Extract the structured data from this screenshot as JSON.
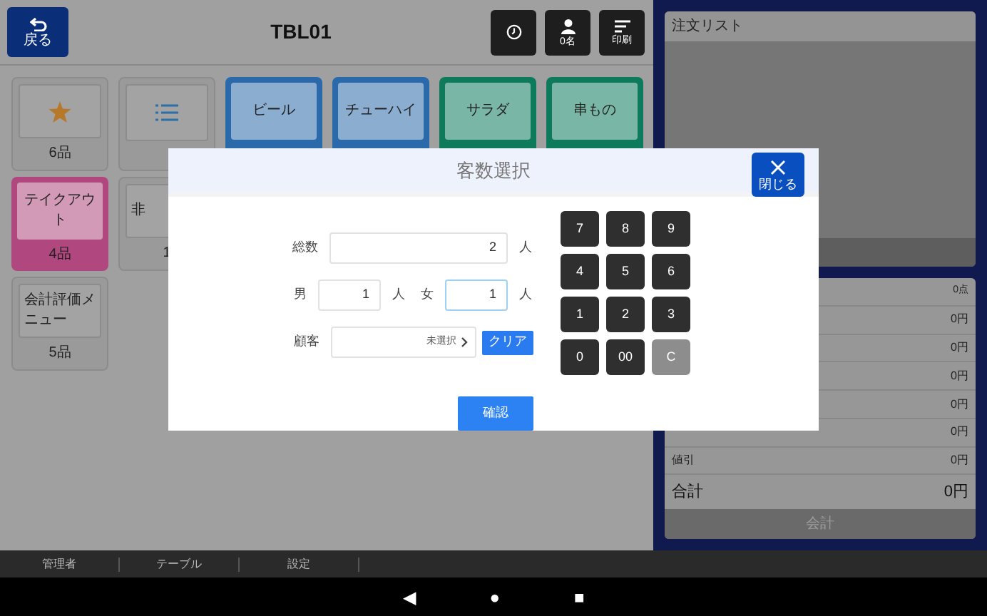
{
  "header": {
    "back_button": "戻る",
    "title": "TBL01",
    "buttons": [
      {
        "kind": "clock"
      },
      {
        "kind": "person",
        "label": "0名"
      },
      {
        "kind": "lines",
        "label": "印刷"
      }
    ]
  },
  "categories": [
    {
      "kind": "star",
      "count": "6品"
    },
    {
      "kind": "list"
    },
    {
      "kind": "color",
      "label": "ビール",
      "color": "#2a6aaa"
    },
    {
      "kind": "color",
      "label": "チューハイ",
      "color": "#2a6aaa"
    },
    {
      "kind": "color",
      "label": "サラダ",
      "color": "#0e7a5c"
    },
    {
      "kind": "color",
      "label": "串もの",
      "color": "#0e7a5c"
    },
    {
      "kind": "color",
      "label": "テイクアウト",
      "count": "4品",
      "color": "#b0477f",
      "new_row": true
    },
    {
      "kind": "plain",
      "label": "非",
      "count": "1"
    },
    {
      "kind": "plain",
      "label": "会計評価メニュー",
      "count": "5品",
      "new_row": true
    }
  ],
  "order_list": {
    "title": "注文リスト"
  },
  "summary": {
    "rows": [
      {
        "value": "0点"
      },
      {
        "value": "0円"
      },
      {
        "value": "0円"
      },
      {
        "value": "0円"
      },
      {
        "value": "0円"
      },
      {
        "value": "0円"
      },
      {
        "label": "値引",
        "value": "0円"
      }
    ],
    "total": {
      "label": "合計",
      "value": "0円"
    },
    "checkout_button": "会計"
  },
  "dialog": {
    "title": "客数選択",
    "close_button": "閉じる",
    "total": {
      "label": "総数",
      "value": "2",
      "unit": "人",
      "focused": false
    },
    "male": {
      "label": "男",
      "value": "1",
      "unit": "人",
      "focused": false
    },
    "female": {
      "label": "女",
      "value": "1",
      "unit": "人",
      "focused": true
    },
    "customer": {
      "label": "顧客",
      "value": "未選択",
      "clear_button": "クリア"
    },
    "confirm_button": "確認",
    "keypad": [
      {
        "key": "7",
        "kind": "digit"
      },
      {
        "key": "8",
        "kind": "digit"
      },
      {
        "key": "9",
        "kind": "digit"
      },
      {
        "key": "4",
        "kind": "digit"
      },
      {
        "key": "5",
        "kind": "digit"
      },
      {
        "key": "6",
        "kind": "digit"
      },
      {
        "key": "1",
        "kind": "digit"
      },
      {
        "key": "2",
        "kind": "digit"
      },
      {
        "key": "3",
        "kind": "digit"
      },
      {
        "key": "0",
        "kind": "digit"
      },
      {
        "key": "00",
        "kind": "digit"
      },
      {
        "key": "C",
        "kind": "clear"
      }
    ]
  },
  "bottom_tabs": [
    "管理者",
    "テーブル",
    "設定"
  ],
  "nav_bar": [
    "◀",
    "●",
    "■"
  ]
}
